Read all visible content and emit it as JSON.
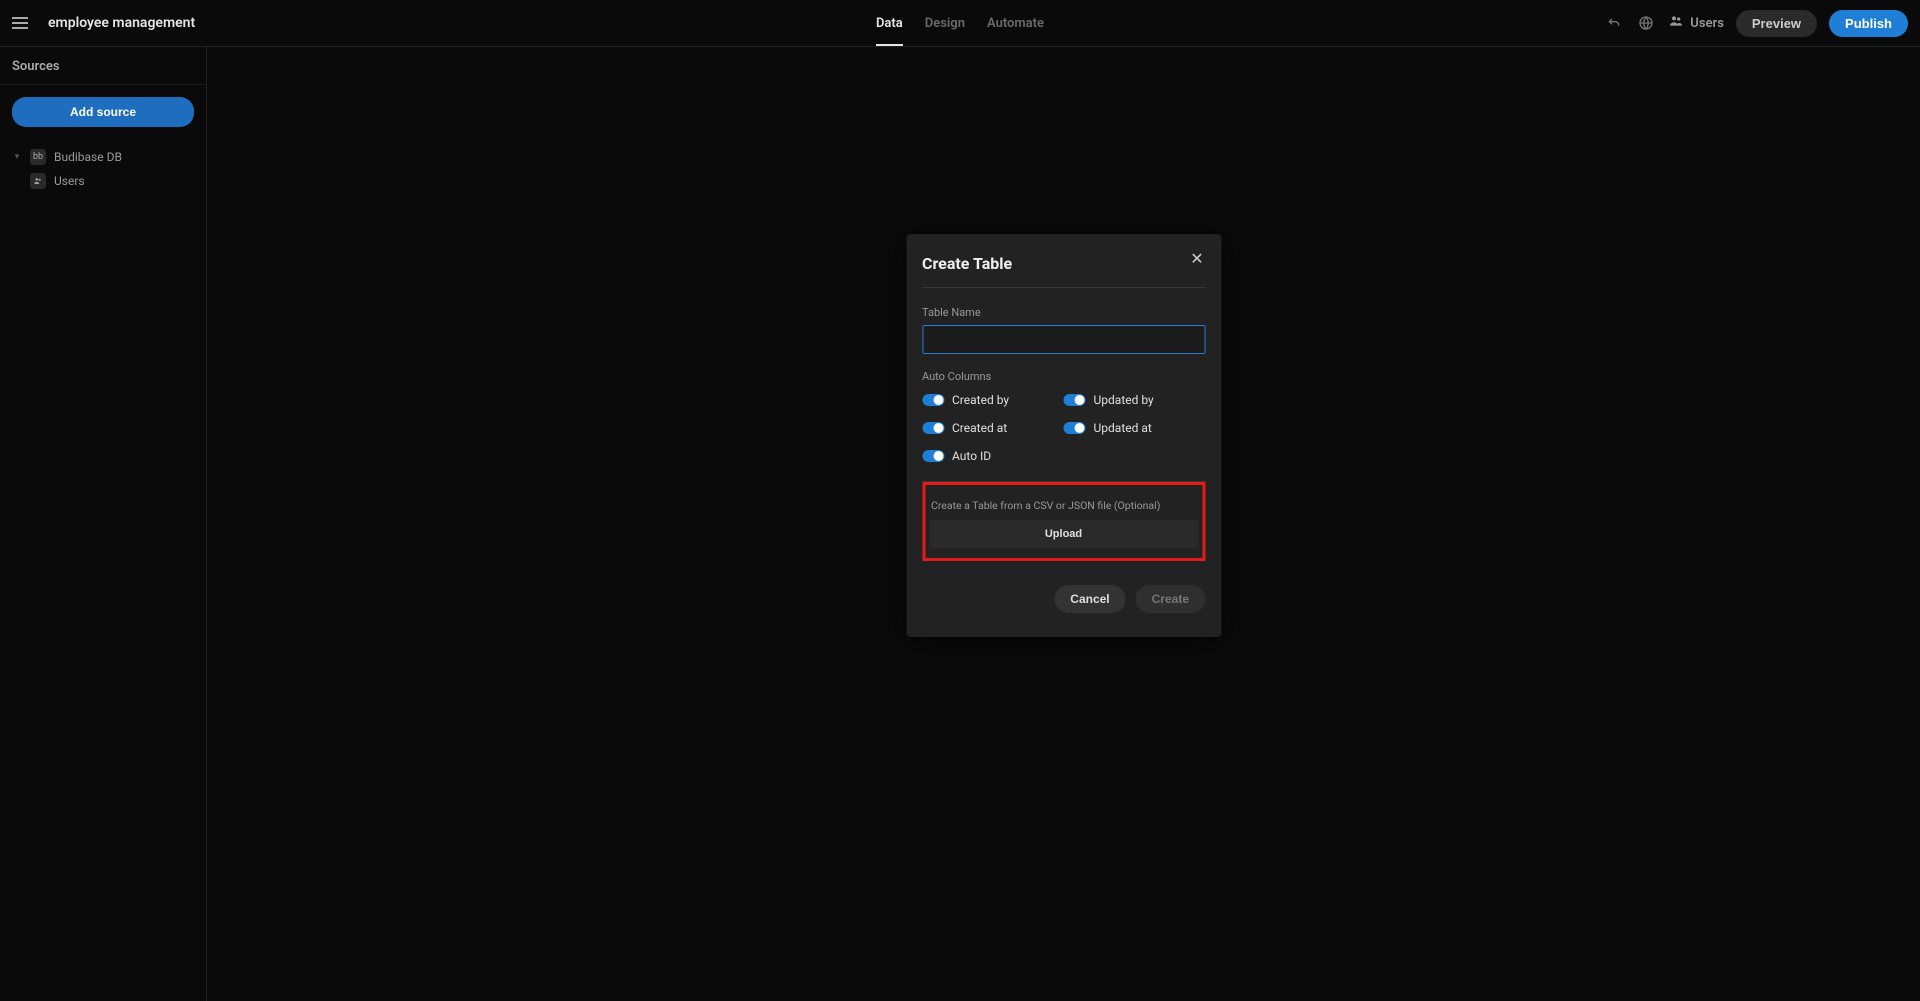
{
  "header": {
    "app_title": "employee management",
    "tabs": [
      {
        "label": "Data",
        "active": true
      },
      {
        "label": "Design",
        "active": false
      },
      {
        "label": "Automate",
        "active": false
      }
    ],
    "users_label": "Users",
    "preview_label": "Preview",
    "publish_label": "Publish"
  },
  "sidebar": {
    "title": "Sources",
    "add_source_label": "Add source",
    "items": [
      {
        "label": "Budibase DB",
        "icon": "bb"
      },
      {
        "label": "Users",
        "icon": "users"
      }
    ]
  },
  "modal": {
    "title": "Create Table",
    "table_name_label": "Table Name",
    "table_name_value": "",
    "auto_columns_label": "Auto Columns",
    "toggles": {
      "created_by": {
        "label": "Created by",
        "on": true
      },
      "updated_by": {
        "label": "Updated by",
        "on": true
      },
      "created_at": {
        "label": "Created at",
        "on": true
      },
      "updated_at": {
        "label": "Updated at",
        "on": true
      },
      "auto_id": {
        "label": "Auto ID",
        "on": true
      }
    },
    "upload_desc": "Create a Table from a CSV or JSON file (Optional)",
    "upload_label": "Upload",
    "cancel_label": "Cancel",
    "create_label": "Create"
  },
  "annotation": {
    "highlight_color": "#e31b1b"
  }
}
